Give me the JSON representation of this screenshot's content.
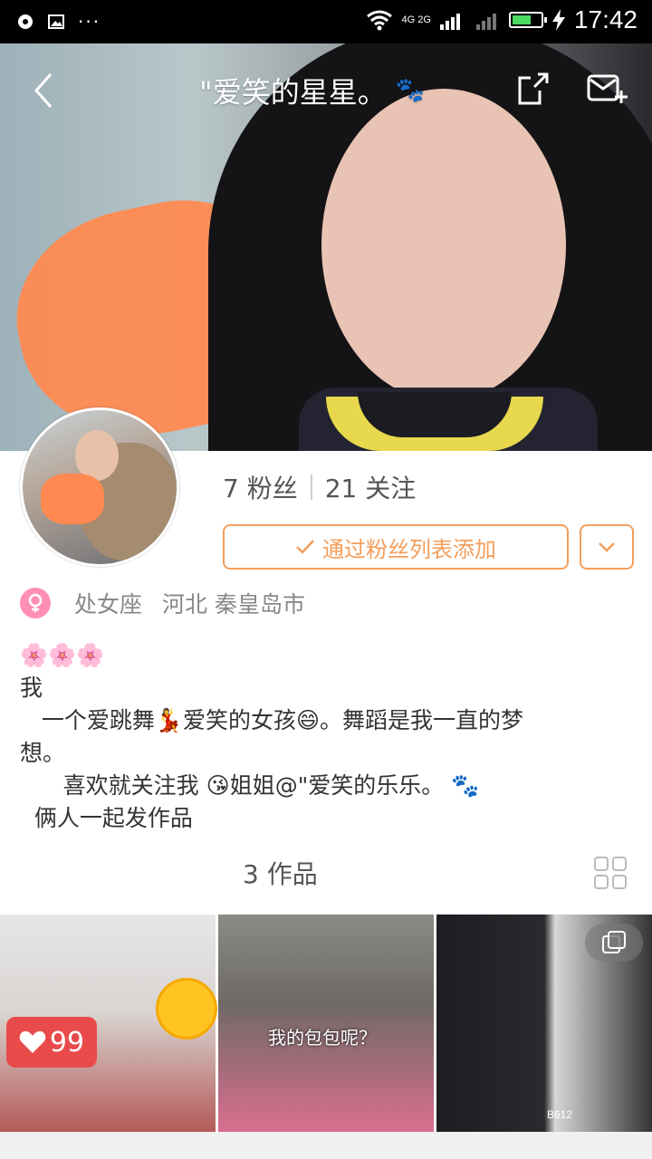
{
  "status_bar": {
    "time": "17:42",
    "network": "4G 2G"
  },
  "header": {
    "title": "\"爱笑的星星。",
    "title_emoji": "🐾"
  },
  "profile": {
    "fans": "7 粉丝",
    "following": "21 关注",
    "follow_button": "通过粉丝列表添加",
    "zodiac": "处女座",
    "location": "河北 秦皇岛市",
    "bio_lines": [
      "🌸🌸🌸",
      "我",
      "   一个爱跳舞💃爱笑的女孩😄。舞蹈是我一直的梦",
      "想。",
      "      喜欢就关注我 😘姐姐@\"爱笑的乐乐。 🐾",
      "  俩人一起发作品"
    ]
  },
  "works": {
    "label": "3 作品",
    "items": [
      {
        "likes": "99"
      },
      {
        "caption": "我的包包呢？"
      },
      {
        "stamp": "B612"
      }
    ]
  },
  "colors": {
    "accent": "#f39e5c",
    "like": "#e94b4b",
    "gender": "#ff8fb4"
  }
}
